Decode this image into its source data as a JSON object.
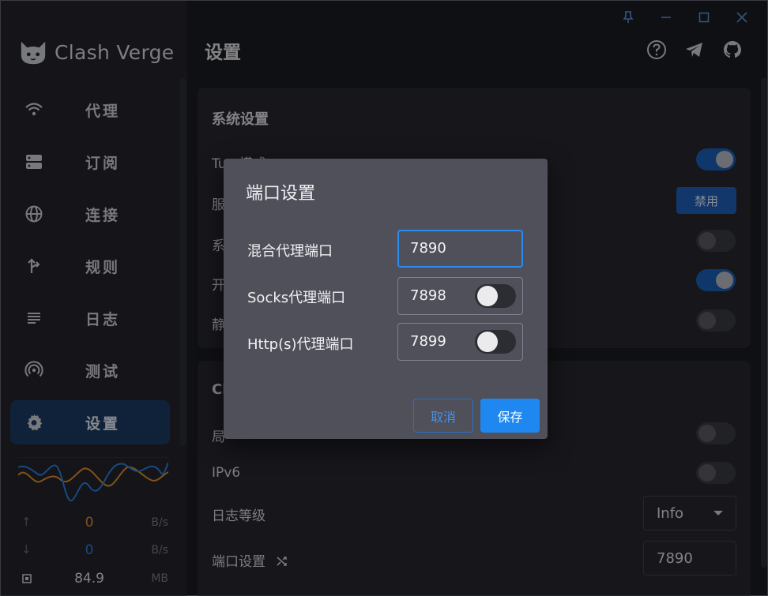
{
  "app": {
    "name": "Clash Verge",
    "page_title": "设置"
  },
  "window_controls": [
    "pin-icon",
    "minimize-icon",
    "maximize-icon",
    "close-icon"
  ],
  "header_icons": [
    "help-icon",
    "telegram-icon",
    "github-icon"
  ],
  "nav": [
    {
      "label": "代理",
      "icon": "wifi-icon"
    },
    {
      "label": "订阅",
      "icon": "storage-icon"
    },
    {
      "label": "连接",
      "icon": "globe-icon"
    },
    {
      "label": "规则",
      "icon": "fork-arrow-icon"
    },
    {
      "label": "日志",
      "icon": "list-icon"
    },
    {
      "label": "测试",
      "icon": "radar-icon"
    },
    {
      "label": "设置",
      "icon": "gear-icon"
    }
  ],
  "traffic": {
    "upload": {
      "value": "0",
      "unit": "B/s",
      "color": "#e0902a"
    },
    "download": {
      "value": "0",
      "unit": "B/s",
      "color": "#2a7fe0"
    },
    "memory": {
      "value": "84.9",
      "unit": "MB"
    }
  },
  "system_settings": {
    "title": "系统设置",
    "tun_label_visible": "Tun 模式",
    "row2_label_fragment": "服",
    "service_button": "禁用",
    "row3_label_fragment": "系",
    "row4_label_fragment": "开",
    "row5_label_fragment": "静",
    "toggles": {
      "tun": true,
      "row3": false,
      "row4": true,
      "row5": false
    }
  },
  "clash_settings": {
    "title_fragment": "Cl",
    "row1_label_fragment": "局",
    "ipv6_label": "IPv6",
    "log_level_label": "日志等级",
    "log_level_value": "Info",
    "port_label": "端口设置",
    "port_value": "7890",
    "toggles": {
      "row1": false,
      "ipv6": false
    }
  },
  "dialog": {
    "title": "端口设置",
    "mixed_label": "混合代理端口",
    "mixed_value": "7890",
    "socks_label": "Socks代理端口",
    "socks_value": "7898",
    "socks_enabled": false,
    "http_label": "Http(s)代理端口",
    "http_value": "7899",
    "http_enabled": false,
    "cancel": "取消",
    "save": "保存"
  },
  "colors": {
    "accent": "#1e88f0",
    "nav_active_bg": "#1d3b63",
    "switch_on": "#1b5fb7"
  }
}
